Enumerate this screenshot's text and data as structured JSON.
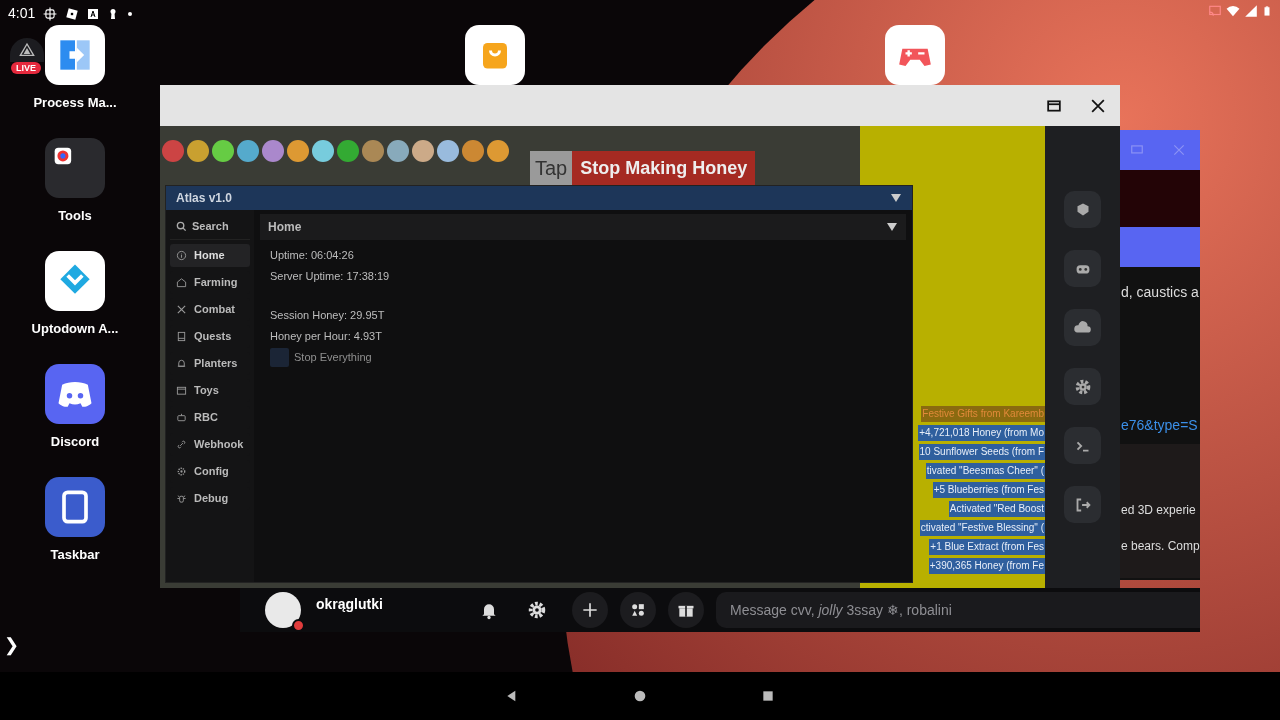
{
  "status_bar": {
    "time": "4:01"
  },
  "live_badge": "LIVE",
  "desktop_icons": [
    {
      "label": "Process Ma...",
      "kind": "process"
    },
    {
      "label": "Tools",
      "kind": "folder"
    },
    {
      "label": "Uptodown A...",
      "kind": "uptodown"
    },
    {
      "label": "Discord",
      "kind": "discord"
    },
    {
      "label": "Taskbar",
      "kind": "taskbar"
    }
  ],
  "edge_handle": "❯",
  "game": {
    "hud_button": {
      "tap": "Tap",
      "label": "Stop Making Honey"
    },
    "log": [
      {
        "text": "Festive Gifts from Kareemb",
        "color": "#8a6a10"
      },
      {
        "text": "+4,721,018 Honey (from Mo",
        "color": "#2f5f9e"
      },
      {
        "text": "10 Sunflower Seeds (from F",
        "color": "#2f5f9e"
      },
      {
        "text": "tivated \"Beesmas Cheer\" (",
        "color": "#2f5f9e"
      },
      {
        "text": "+5 Blueberries (from Fes",
        "color": "#2f5f9e"
      },
      {
        "text": "Activated \"Red Boost",
        "color": "#2f5f9e"
      },
      {
        "text": "ctivated \"Festive Blessing\" (",
        "color": "#2f5f9e"
      },
      {
        "text": "+1 Blue Extract (from Fes",
        "color": "#2f5f9e"
      },
      {
        "text": "+390,365 Honey (from Fe",
        "color": "#2f5f9e"
      }
    ]
  },
  "atlas": {
    "title": "Atlas v1.0",
    "search": "Search",
    "page_title": "Home",
    "nav": [
      {
        "label": "Home",
        "kind": "info",
        "selected": true
      },
      {
        "label": "Farming",
        "kind": "house",
        "selected": false
      },
      {
        "label": "Combat",
        "kind": "swords",
        "selected": false
      },
      {
        "label": "Quests",
        "kind": "book",
        "selected": false
      },
      {
        "label": "Planters",
        "kind": "bell",
        "selected": false
      },
      {
        "label": "Toys",
        "kind": "calendar",
        "selected": false
      },
      {
        "label": "RBC",
        "kind": "robot",
        "selected": false
      },
      {
        "label": "Webhook",
        "kind": "link",
        "selected": false
      },
      {
        "label": "Config",
        "kind": "gear",
        "selected": false
      },
      {
        "label": "Debug",
        "kind": "bug",
        "selected": false
      }
    ],
    "lines": [
      [
        "Uptime: 06:04:26",
        "Server Uptime: 17:38:19"
      ],
      [
        "Session Honey: 29.95T",
        "Honey per Hour: 4.93T"
      ]
    ],
    "toggle": {
      "label": "Stop Everything",
      "checked": false
    }
  },
  "discord": {
    "snippets": [
      "d, caustics a",
      "e76&type=S",
      "ed 3D experie",
      "e bears. Comp"
    ],
    "user": "okrąglutki",
    "message_placeholder": "Message cvv, *jolly* 3ssay ❄, robalini"
  }
}
